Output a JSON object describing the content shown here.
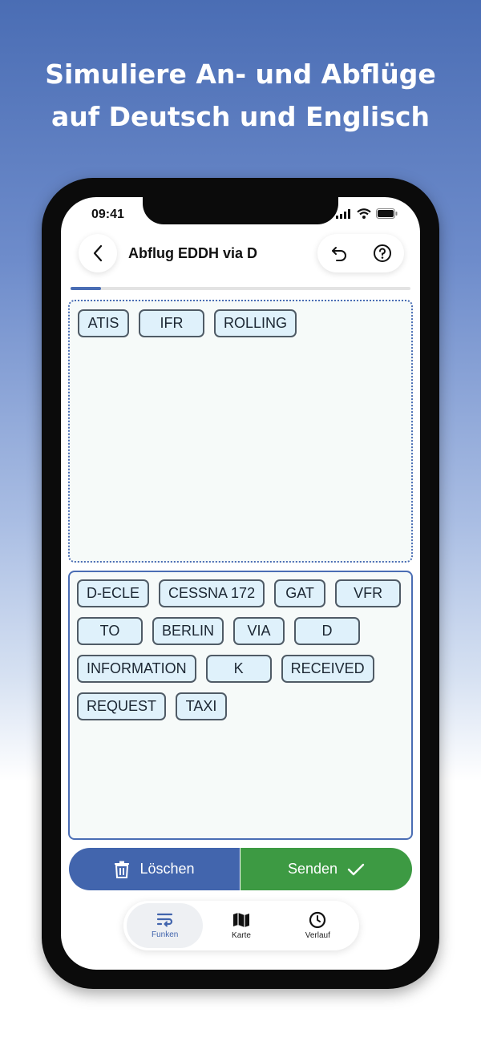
{
  "headline": {
    "line1": "Simuliere An- und Abflüge",
    "line2": "auf Deutsch und Englisch"
  },
  "status_bar": {
    "time": "09:41",
    "icons": [
      "cellular-signal-icon",
      "wifi-icon",
      "battery-icon"
    ]
  },
  "header": {
    "title": "Abflug EDDH via D",
    "back_icon": "chevron-left-icon",
    "undo_icon": "undo-icon",
    "help_icon": "help-circle-icon"
  },
  "progress": {
    "value_percent": 9
  },
  "answer_chips": [
    "ATIS",
    "IFR",
    "ROLLING"
  ],
  "pool_chips": [
    "D-ECLE",
    "CESSNA 172",
    "GAT",
    "VFR",
    "TO",
    "BERLIN",
    "VIA",
    "D",
    "INFORMATION",
    "K",
    "RECEIVED",
    "REQUEST",
    "TAXI"
  ],
  "actions": {
    "delete_label": "Löschen",
    "delete_icon": "trash-icon",
    "send_label": "Senden",
    "send_icon": "checkmark-icon"
  },
  "tabbar": {
    "tabs": [
      {
        "label": "Funken",
        "icon": "radio-transmit-icon",
        "active": true
      },
      {
        "label": "Karte",
        "icon": "map-icon",
        "active": false
      },
      {
        "label": "Verlauf",
        "icon": "clock-icon",
        "active": false
      }
    ]
  },
  "colors": {
    "accent_blue": "#4265ad",
    "send_green": "#3d9a43",
    "chip_fill": "#dff1fb"
  }
}
